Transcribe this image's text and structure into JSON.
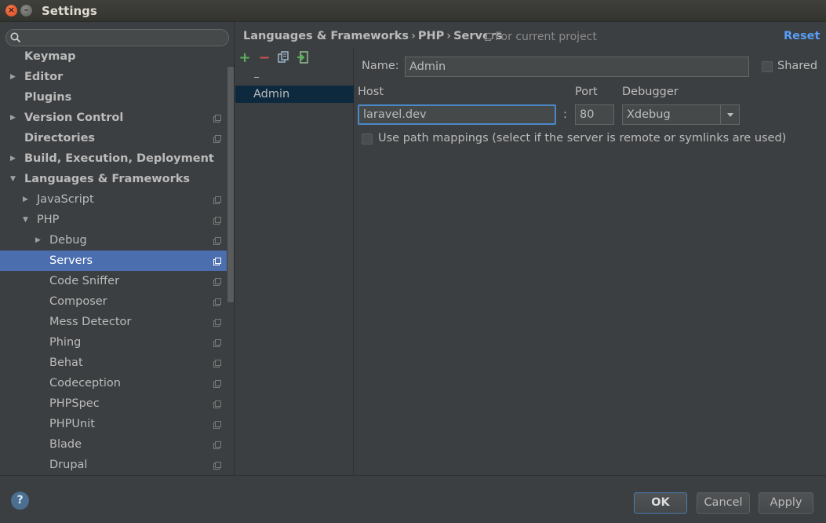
{
  "window": {
    "title": "Settings"
  },
  "search": {
    "placeholder": ""
  },
  "tree": [
    {
      "label": "Keymap"
    },
    {
      "label": "Editor"
    },
    {
      "label": "Plugins"
    },
    {
      "label": "Version Control"
    },
    {
      "label": "Directories"
    },
    {
      "label": "Build, Execution, Deployment"
    },
    {
      "label": "Languages & Frameworks"
    },
    {
      "label": "JavaScript"
    },
    {
      "label": "PHP"
    },
    {
      "label": "Debug"
    },
    {
      "label": "Servers"
    },
    {
      "label": "Code Sniffer"
    },
    {
      "label": "Composer"
    },
    {
      "label": "Mess Detector"
    },
    {
      "label": "Phing"
    },
    {
      "label": "Behat"
    },
    {
      "label": "Codeception"
    },
    {
      "label": "PHPSpec"
    },
    {
      "label": "PHPUnit"
    },
    {
      "label": "Blade"
    },
    {
      "label": "Drupal"
    }
  ],
  "header": {
    "crumb1": "Languages & Frameworks",
    "crumb2": "PHP",
    "crumb3": "Servers",
    "separator": "›",
    "scope": "For current project",
    "reset": "Reset"
  },
  "servers": {
    "add": "+",
    "remove": "−",
    "items": [
      {
        "label": "Admin"
      }
    ]
  },
  "form": {
    "name_label": "Name:",
    "name_value": "Admin",
    "shared_label": "Shared",
    "host_label": "Host",
    "host_value": "laravel.dev",
    "colon": ":",
    "port_label": "Port",
    "port_value": "80",
    "debugger_label": "Debugger",
    "debugger_value": "Xdebug",
    "mappings_label": "Use path mappings (select if the server is remote or symlinks are used)"
  },
  "footer": {
    "help": "?",
    "ok": "OK",
    "cancel": "Cancel",
    "apply": "Apply"
  }
}
